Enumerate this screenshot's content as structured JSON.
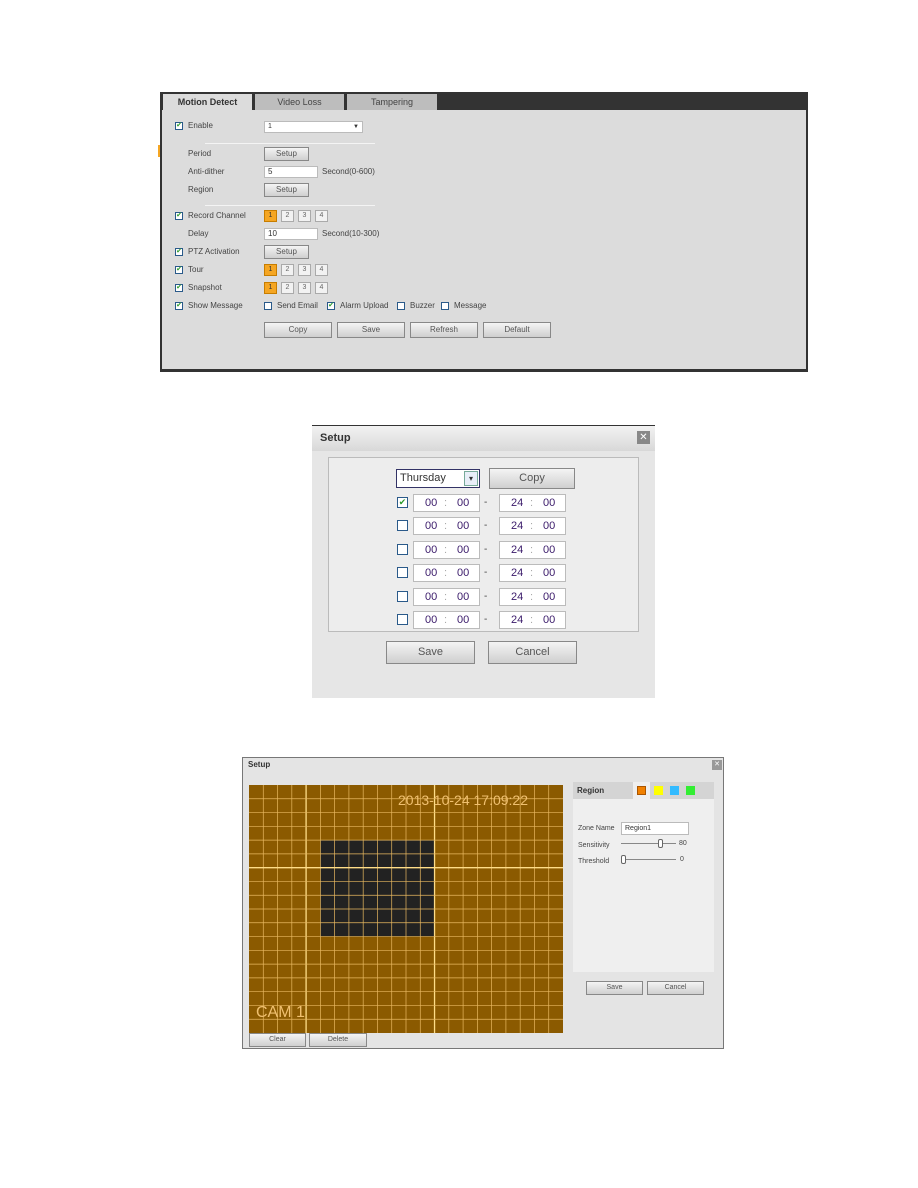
{
  "motion": {
    "tabs": [
      "Motion Detect",
      "Video Loss",
      "Tampering"
    ],
    "enable_label": "Enable",
    "channel_value": "1",
    "period_label": "Period",
    "setup_label": "Setup",
    "antidither_label": "Anti-dither",
    "antidither_value": "5",
    "antidither_range": "Second(0-600)",
    "region_label": "Region",
    "record_label": "Record Channel",
    "delay_label": "Delay",
    "delay_value": "10",
    "delay_range": "Second(10-300)",
    "ptz_label": "PTZ Activation",
    "tour_label": "Tour",
    "snapshot_label": "Snapshot",
    "channels": [
      "1",
      "2",
      "3",
      "4"
    ],
    "show_message_label": "Show Message",
    "send_email_label": "Send Email",
    "alarm_upload_label": "Alarm Upload",
    "buzzer_label": "Buzzer",
    "message_label": "Message",
    "buttons": [
      "Copy",
      "Save",
      "Refresh",
      "Default"
    ],
    "accent": "#f5a623"
  },
  "period": {
    "title": "Setup",
    "day": "Thursday",
    "copy_label": "Copy",
    "periods": [
      {
        "checked": true,
        "sh": "00",
        "sm": "00",
        "eh": "24",
        "em": "00"
      },
      {
        "checked": false,
        "sh": "00",
        "sm": "00",
        "eh": "24",
        "em": "00"
      },
      {
        "checked": false,
        "sh": "00",
        "sm": "00",
        "eh": "24",
        "em": "00"
      },
      {
        "checked": false,
        "sh": "00",
        "sm": "00",
        "eh": "24",
        "em": "00"
      },
      {
        "checked": false,
        "sh": "00",
        "sm": "00",
        "eh": "24",
        "em": "00"
      },
      {
        "checked": false,
        "sh": "00",
        "sm": "00",
        "eh": "24",
        "em": "00"
      }
    ],
    "sep": ":",
    "dash": "-",
    "save_label": "Save",
    "cancel_label": "Cancel"
  },
  "region": {
    "title": "Setup",
    "timestamp": "2013-10-24 17:09:22",
    "cam_label": "CAM 1",
    "panel_title": "Region",
    "region_colors": [
      "#f08000",
      "#ffff00",
      "#33bbff",
      "#33ee33"
    ],
    "zone_name_label": "Zone Name",
    "zone_name_value": "Region1",
    "sensitivity_label": "Sensitivity",
    "sensitivity_value": "80",
    "threshold_label": "Threshold",
    "threshold_value": "0",
    "save_label": "Save",
    "cancel_label": "Cancel",
    "clear_label": "Clear",
    "delete_label": "Delete",
    "grid_color": "#8b5a00"
  }
}
